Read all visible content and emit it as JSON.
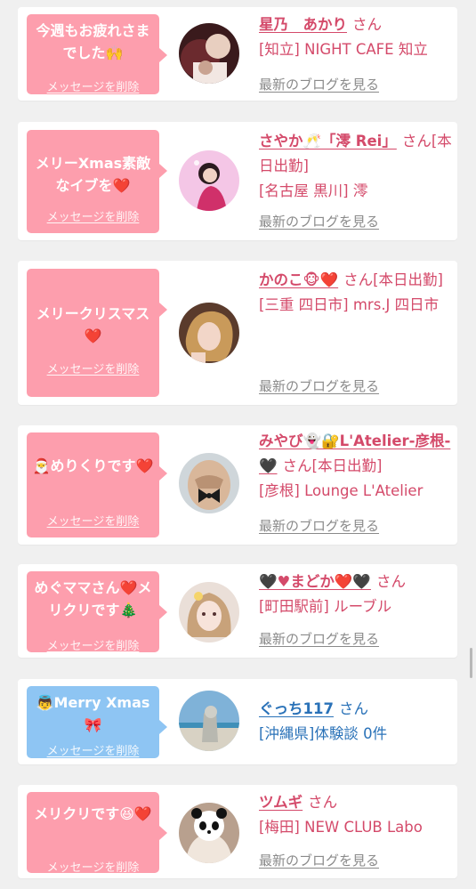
{
  "cards": [
    {
      "message": "今週もお疲れさまでした🙌",
      "delete_label": "メッセージを削除",
      "name": "星乃　あかり",
      "san": "さん",
      "detail": "[知立] NIGHT CAFE 知立",
      "blog_label": "最新のブログを見る"
    },
    {
      "message": "メリーXmas素敵なイブを❤️",
      "delete_label": "メッセージを削除",
      "name": "さやか🥂「澪 Rei」",
      "san": "さん",
      "status": "[本日出勤]",
      "detail": "[名古屋 黒川] 澪",
      "blog_label": "最新のブログを見る"
    },
    {
      "message": "メリークリスマス❤️",
      "delete_label": "メッセージを削除",
      "name": "かのこ🐵❤️",
      "san": "さん",
      "status": "[本日出勤]",
      "detail": "[三重 四日市] mrs.J 四日市",
      "blog_label": "最新のブログを見る"
    },
    {
      "message": "🎅めりくりです❤️",
      "delete_label": "メッセージを削除",
      "name": "みやび👻🔐L'Atelier-彦根-🖤",
      "san": "さん",
      "status": "[本日出勤]",
      "detail": "[彦根] Lounge L'Atelier",
      "blog_label": "最新のブログを見る"
    },
    {
      "message": "めぐママさん❤️メリクリです🎄",
      "delete_label": "メッセージを削除",
      "name": "🖤♥まどか❤️🖤",
      "san": "さん",
      "detail": "[町田駅前] ルーブル",
      "blog_label": "最新のブログを見る"
    },
    {
      "message": "👼Merry Xmas🎀",
      "delete_label": "メッセージを削除",
      "name": "ぐっち117",
      "san": "さん",
      "detail": "[沖縄県]体験談 0件"
    },
    {
      "message": "メリクリです😆❤️",
      "delete_label": "メッセージを削除",
      "name": "ツムギ",
      "san": "さん",
      "detail": "[梅田] NEW CLUB Labo",
      "blog_label": "最新のブログを見る"
    }
  ],
  "colors": {
    "pink_bubble": "#fd9ead",
    "blue_bubble": "#8ec5f3",
    "name_pink": "#d44a6a",
    "name_blue": "#2a72b8",
    "blog_gray": "#8a8a8a",
    "background": "#f0f0f0"
  },
  "icons": [
    "user-avatar-photo",
    "speech-bubble-arrow",
    "scrollbar-thumb"
  ]
}
